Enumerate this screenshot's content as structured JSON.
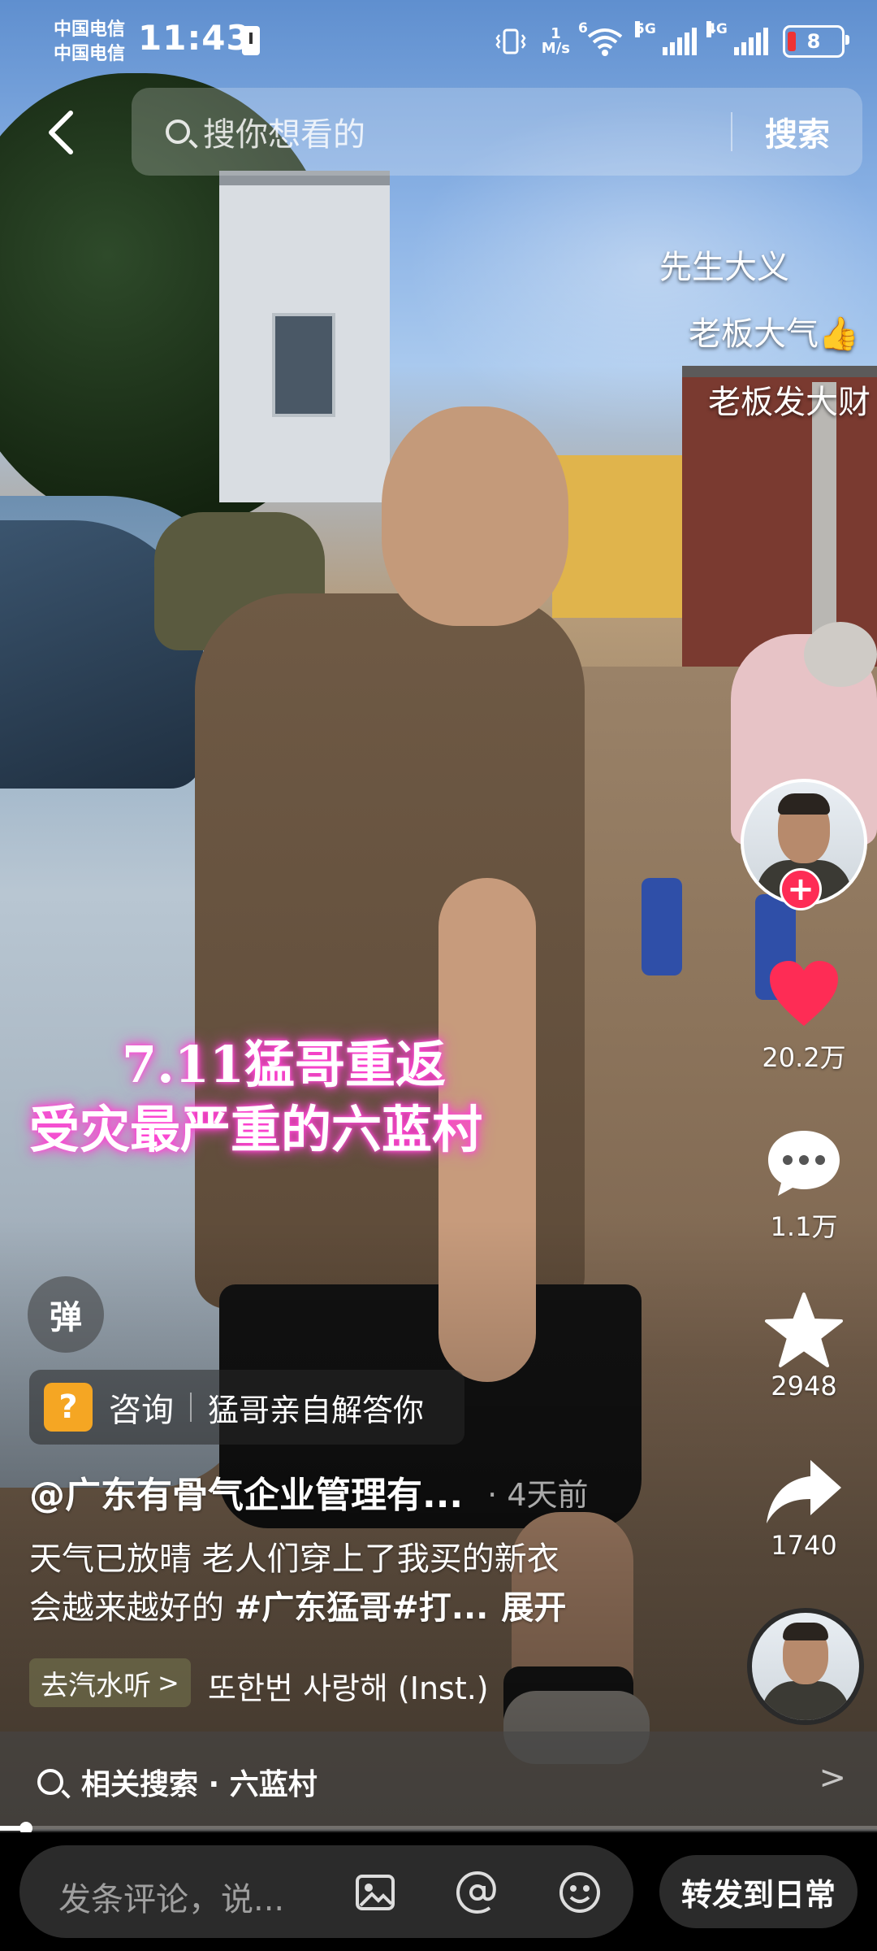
{
  "status_bar": {
    "carrier_1": "中国电信",
    "carrier_2": "中国电信",
    "time": "11:43",
    "net_speed_value": "1",
    "net_speed_unit": "M/s",
    "wifi_label": "6",
    "signal_1_label": "5G",
    "signal_2_label": "4G",
    "battery_level": "8"
  },
  "search": {
    "placeholder": "搜你想看的",
    "button_label": "搜索"
  },
  "danmaku": [
    "先生大义",
    "老板大气👍",
    "老板发大财"
  ],
  "video": {
    "caption_line_1": "7.11猛哥重返",
    "caption_line_2": "受灾最严重的六蓝村"
  },
  "actions": {
    "follow_symbol": "+",
    "likes": "20.2万",
    "comments": "1.1万",
    "favorites": "2948",
    "shares": "1740"
  },
  "danmu_toggle_label": "弹",
  "consult": {
    "icon_glyph": "?",
    "label": "咨询",
    "description": "猛哥亲自解答你"
  },
  "post": {
    "author": "@广东有骨气企业管理有...",
    "time": "· 4天前",
    "desc_line_1": "天气已放晴 老人们穿上了我买的新衣",
    "desc_line_2_text": "会越来越好的 ",
    "desc_line_2_hashtag": "#广东猛哥#打...",
    "expand_label": "展开"
  },
  "music": {
    "chip_label": "去汽水听",
    "chip_arrow": ">",
    "title": "또한번 사랑해 (Inst.)"
  },
  "related": {
    "label": "相关搜索 · 六蓝村",
    "chevron": ">"
  },
  "progress": {
    "fraction": 0.03
  },
  "comment_bar": {
    "placeholder": "发条评论，说...",
    "repost_label": "转发到日常"
  },
  "colors": {
    "like_red": "#fe2c55",
    "caption_glow": "#ff3fd2",
    "consult_orange": "#f5a623"
  }
}
